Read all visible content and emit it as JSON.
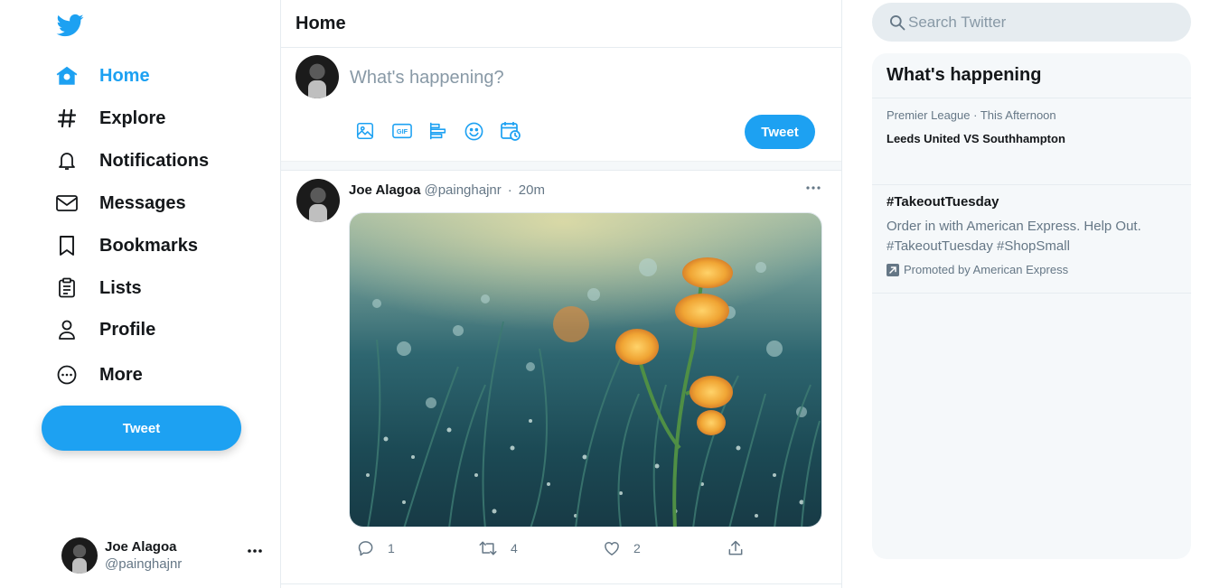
{
  "colors": {
    "accent": "#1da1f2",
    "text_primary": "#14171a",
    "text_secondary": "#657786",
    "panel_bg": "#f5f8fa"
  },
  "sidebar": {
    "logo_icon": "twitter-bird-icon",
    "nav": [
      {
        "label": "Home",
        "icon": "home-icon",
        "active": true
      },
      {
        "label": "Explore",
        "icon": "hashtag-icon"
      },
      {
        "label": "Notifications",
        "icon": "bell-icon"
      },
      {
        "label": "Messages",
        "icon": "envelope-icon"
      },
      {
        "label": "Bookmarks",
        "icon": "bookmark-icon"
      },
      {
        "label": "Lists",
        "icon": "list-icon"
      },
      {
        "label": "Profile",
        "icon": "person-icon"
      },
      {
        "label": "More",
        "icon": "more-circle-icon"
      }
    ],
    "tweet_button": "Tweet",
    "account": {
      "name": "Joe Alagoa",
      "handle": "@painghajnr"
    }
  },
  "main": {
    "title": "Home",
    "composer": {
      "placeholder": "What's happening?",
      "tools": [
        "image-icon",
        "gif-icon",
        "poll-icon",
        "emoji-icon",
        "schedule-icon"
      ],
      "tweet_button": "Tweet"
    },
    "tweet": {
      "name": "Joe Alagoa",
      "handle": "@painghajnr",
      "separator": "·",
      "time": "20m",
      "media": "photo of yellow flowers in dewy grass",
      "actions": {
        "replies": "1",
        "retweets": "4",
        "likes": "2"
      }
    }
  },
  "right": {
    "search_placeholder": "Search Twitter",
    "trends_title": "What's happening",
    "trends": [
      {
        "meta": "Premier League · This Afternoon",
        "headline": "Leeds United VS Southhampton"
      },
      {
        "tag": "#TakeoutTuesday",
        "description": "Order in with American Express. Help Out. #TakeoutTuesday #ShopSmall",
        "promoted": "Promoted by American Express"
      }
    ]
  }
}
